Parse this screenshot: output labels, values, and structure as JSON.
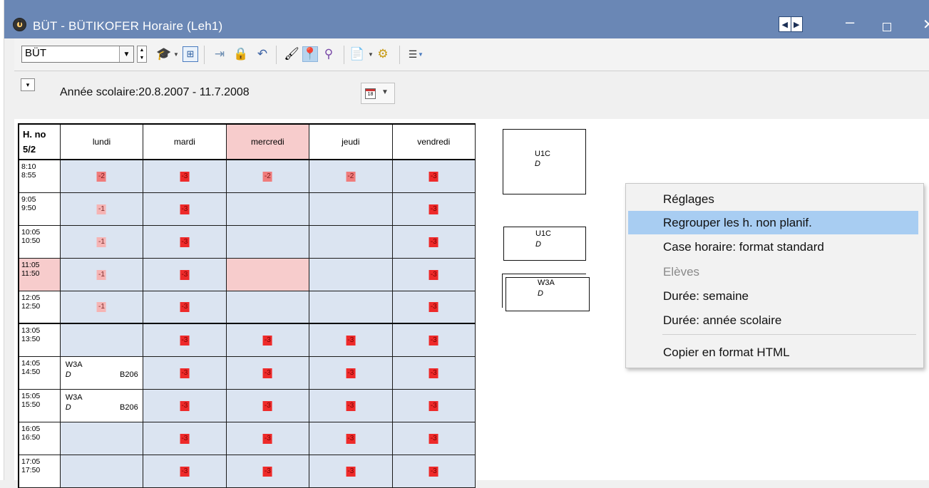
{
  "window": {
    "title": "BÜT - BÜTIKOFER  Horaire  (Leh1)",
    "nav_left": "◀",
    "nav_right": "▶",
    "minimize": "–",
    "close": "✕"
  },
  "toolbar": {
    "teacher_value": "BÜT",
    "combo_arrow": "▼"
  },
  "header": {
    "dropdown_arrow": "▾",
    "school_year": "Année scolaire:20.8.2007 - 11.7.2008",
    "calendar_day": "18",
    "calendar_arrow": "▼"
  },
  "timetable": {
    "corner_line1": "H. no",
    "corner_line2": "5/2",
    "days": [
      "lundi",
      "mardi",
      "mercredi",
      "jeudi",
      "vendredi"
    ],
    "highlighted_day": "mercredi",
    "rows": [
      {
        "start": "8:10",
        "end": "8:55",
        "cells": [
          "-2",
          "-3",
          "-2",
          "-2",
          "-3"
        ]
      },
      {
        "start": "9:05",
        "end": "9:50",
        "cells": [
          "-1",
          "-3",
          "",
          "",
          "-3"
        ]
      },
      {
        "start": "10:05",
        "end": "10:50",
        "cells": [
          "-1",
          "-3",
          "",
          "",
          "-3"
        ]
      },
      {
        "start": "11:05",
        "end": "11:50",
        "cells": [
          "-1",
          "-3",
          "",
          "",
          "-3"
        ]
      },
      {
        "start": "12:05",
        "end": "12:50",
        "cells": [
          "-1",
          "-3",
          "",
          "",
          "-3"
        ]
      },
      {
        "start": "13:05",
        "end": "13:50",
        "cells": [
          "",
          "-3",
          "-3",
          "-3",
          "-3"
        ]
      },
      {
        "start": "14:05",
        "end": "14:50",
        "cells": [
          "",
          "-3",
          "-3",
          "-3",
          "-3"
        ]
      },
      {
        "start": "15:05",
        "end": "15:50",
        "cells": [
          "",
          "-3",
          "-3",
          "-3",
          "-3"
        ]
      },
      {
        "start": "16:05",
        "end": "16:50",
        "cells": [
          "",
          "-3",
          "-3",
          "-3",
          "-3"
        ]
      },
      {
        "start": "17:05",
        "end": "17:50",
        "cells": [
          "",
          "-3",
          "-3",
          "-3",
          "-3"
        ]
      }
    ],
    "lessons": [
      {
        "class": "W3A",
        "teacher": "D",
        "room": "B206"
      },
      {
        "class": "W3A",
        "teacher": "D",
        "room": "B206"
      }
    ]
  },
  "unplanned": [
    {
      "class": "U1C",
      "teacher": "D"
    },
    {
      "class": "U1C",
      "teacher": "D"
    },
    {
      "class": "W3A",
      "teacher": "D"
    }
  ],
  "context_menu": {
    "items": [
      {
        "label": "Réglages",
        "state": "normal"
      },
      {
        "label": "Regrouper les h. non planif.",
        "state": "hover"
      },
      {
        "label": "Case horaire: format standard",
        "state": "normal"
      },
      {
        "label": "Elèves",
        "state": "disabled"
      },
      {
        "label": "Durée: semaine",
        "state": "normal"
      },
      {
        "label": "Durée: année scolaire",
        "state": "normal"
      },
      {
        "label": "Copier en format HTML",
        "state": "normal"
      }
    ]
  },
  "colors": {
    "titlebar": "#6a87b5",
    "cell_bg": "#dbe4f1",
    "highlight": "#f7cccc",
    "menu_hover": "#a8cdf2",
    "badge_strong": "#ee2a2a",
    "badge_medium": "#f07b7b",
    "badge_light": "#f6b4b4"
  }
}
